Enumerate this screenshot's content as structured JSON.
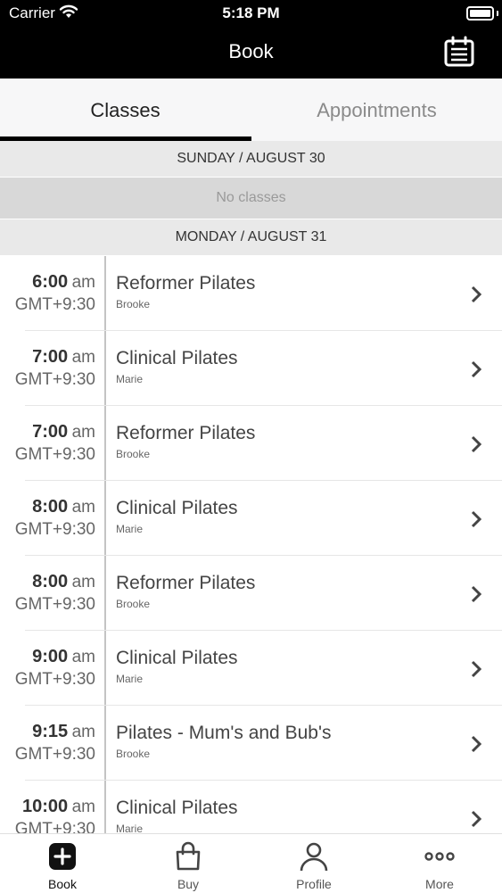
{
  "status_bar": {
    "carrier": "Carrier",
    "time": "5:18 PM"
  },
  "nav": {
    "title": "Book",
    "calendar_icon": "calendar-list-icon"
  },
  "tabs": [
    {
      "label": "Classes",
      "active": true
    },
    {
      "label": "Appointments",
      "active": false
    }
  ],
  "days": [
    {
      "header": "SUNDAY / AUGUST 30",
      "empty_text": "No classes"
    },
    {
      "header": "MONDAY / AUGUST 31"
    }
  ],
  "classes": [
    {
      "time": "6:00",
      "ampm": "am",
      "tz": "GMT+9:30",
      "name": "Reformer Pilates",
      "instructor": "Brooke"
    },
    {
      "time": "7:00",
      "ampm": "am",
      "tz": "GMT+9:30",
      "name": "Clinical Pilates",
      "instructor": "Marie"
    },
    {
      "time": "7:00",
      "ampm": "am",
      "tz": "GMT+9:30",
      "name": "Reformer Pilates",
      "instructor": "Brooke"
    },
    {
      "time": "8:00",
      "ampm": "am",
      "tz": "GMT+9:30",
      "name": "Clinical Pilates",
      "instructor": "Marie"
    },
    {
      "time": "8:00",
      "ampm": "am",
      "tz": "GMT+9:30",
      "name": "Reformer Pilates",
      "instructor": "Brooke"
    },
    {
      "time": "9:00",
      "ampm": "am",
      "tz": "GMT+9:30",
      "name": "Clinical Pilates",
      "instructor": "Marie"
    },
    {
      "time": "9:15",
      "ampm": "am",
      "tz": "GMT+9:30",
      "name": "Pilates - Mum's and Bub's",
      "instructor": "Brooke"
    },
    {
      "time": "10:00",
      "ampm": "am",
      "tz": "GMT+9:30",
      "name": "Clinical Pilates",
      "instructor": "Marie"
    }
  ],
  "tab_bar": [
    {
      "label": "Book",
      "icon": "plus-square-icon",
      "active": true
    },
    {
      "label": "Buy",
      "icon": "shopping-bag-icon",
      "active": false
    },
    {
      "label": "Profile",
      "icon": "person-icon",
      "active": false
    },
    {
      "label": "More",
      "icon": "more-dots-icon",
      "active": false
    }
  ],
  "colors": {
    "header_bg": "#000000",
    "active_tab": "#000000",
    "inactive_text": "#8a8a8a",
    "day_header_bg": "#e9e9e9",
    "no_classes_bg": "#d8d8d8"
  }
}
